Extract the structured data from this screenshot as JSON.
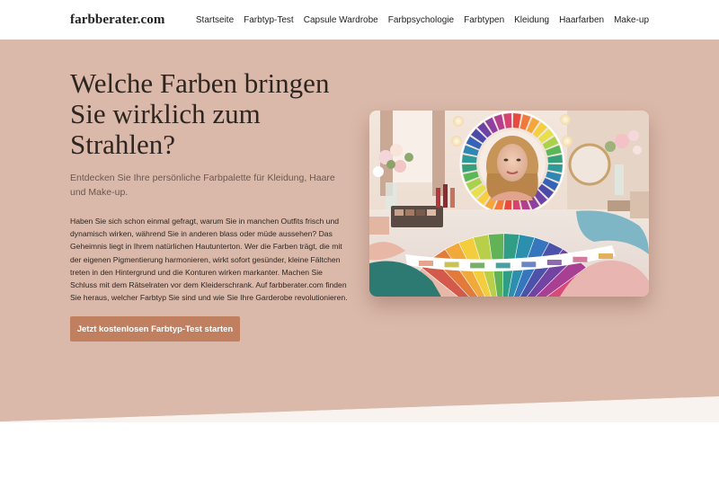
{
  "header": {
    "logo": "farbberater.com",
    "nav": [
      {
        "label": "Startseite"
      },
      {
        "label": "Farbtyp-Test"
      },
      {
        "label": "Capsule Wardrobe"
      },
      {
        "label": "Farbpsychologie"
      },
      {
        "label": "Farbtypen"
      },
      {
        "label": "Kleidung"
      },
      {
        "label": "Haarfarben"
      },
      {
        "label": "Make-up"
      }
    ]
  },
  "hero": {
    "title": "Welche Farben bringen Sie wirklich zum Strahlen?",
    "subtitle": "Entdecken Sie Ihre persönliche Farbpalette für Kleidung, Haare und Make-up.",
    "body": "Haben Sie sich schon einmal gefragt, warum Sie in manchen Outfits frisch und dynamisch wirken, während Sie in anderen blass oder müde aussehen? Das Geheimnis liegt in Ihrem natürlichen Hautunterton. Wer die Farben trägt, die mit der eigenen Pigmentierung harmonieren, wirkt sofort gesünder, kleine Fältchen treten in den Hintergrund und die Konturen wirken markanter. Machen Sie Schluss mit dem Rätselraten vor dem Kleiderschrank. Auf farbberater.com finden Sie heraus, welcher Farbtyp Sie sind und wie Sie Ihre Garderobe revolutionieren.",
    "cta_label": "Jetzt kostenlosen Farbtyp-Test starten"
  },
  "colors": {
    "hero_bg": "#dbb9aa",
    "cta_bg": "#c08060",
    "band_bg": "#f8f3ef",
    "page_bg": "#ffffff"
  }
}
